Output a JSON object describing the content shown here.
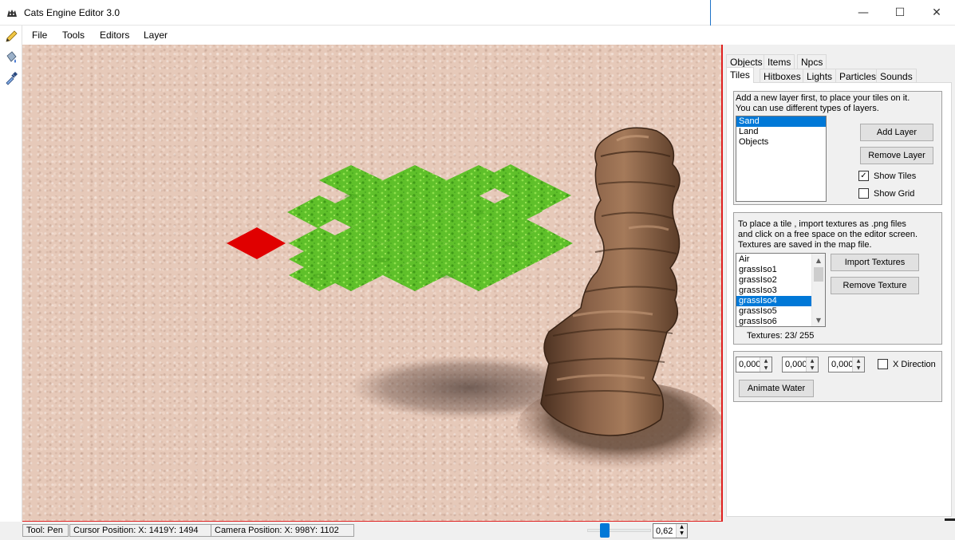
{
  "window": {
    "title": "Cats Engine Editor 3.0",
    "minimize_glyph": "—",
    "maximize_glyph": "☐",
    "close_glyph": "✕"
  },
  "menu": {
    "file": "File",
    "tools": "Tools",
    "editors": "Editors",
    "layer": "Layer"
  },
  "tools": [
    "pencil-icon",
    "bucket-icon",
    "eyedropper-icon"
  ],
  "tabs": {
    "row1": [
      "Objects",
      "Items",
      "Npcs"
    ],
    "row2": [
      "Tiles",
      "Hitboxes",
      "Lights",
      "Particles",
      "Sounds"
    ],
    "active": "Tiles"
  },
  "layers": {
    "description_1": "Add a new layer first, to place your tiles on it.",
    "description_2": "You can use different types of layers.",
    "items": [
      "Sand",
      "Land",
      "Objects"
    ],
    "selected": "Sand",
    "add_button": "Add Layer",
    "remove_button": "Remove Layer",
    "show_tiles_label": "Show Tiles",
    "show_tiles_checked": true,
    "show_grid_label": "Show Grid",
    "show_grid_checked": false
  },
  "textures": {
    "description_1": "To place a tile , import textures as .png files",
    "description_2": "and click on a free space on the editor screen.",
    "description_3": "Textures are saved in the map file.",
    "items": [
      "Air",
      "grassIso1",
      "grassIso2",
      "grassIso3",
      "grassIso4",
      "grassIso5",
      "grassIso6"
    ],
    "selected": "grassIso4",
    "import_button": "Import Textures",
    "remove_button": "Remove Texture",
    "count_label": "Textures: 23/ 255",
    "scroll_up_glyph": "▲",
    "scroll_down_glyph": "▼"
  },
  "water": {
    "value_1": "0,000",
    "value_2": "0,000",
    "value_3": "0,000",
    "x_direction_label": "X Direction",
    "x_direction_checked": false,
    "animate_button": "Animate Water"
  },
  "status": {
    "tool": "Tool: Pen",
    "cursor": "Cursor Position: X: 1419Y: 1494",
    "camera": "Camera Position: X: 998Y: 1102",
    "zoom": "0,62",
    "zoom_fraction": 0.2
  },
  "spin_up_glyph": "▲",
  "spin_down_glyph": "▼",
  "check_glyph": "✓",
  "colors": {
    "accent": "#0078d7",
    "canvas_border": "#e02020",
    "grass": "#5fc02a",
    "marker": "#e00000",
    "sand": "#e6c9b9"
  }
}
